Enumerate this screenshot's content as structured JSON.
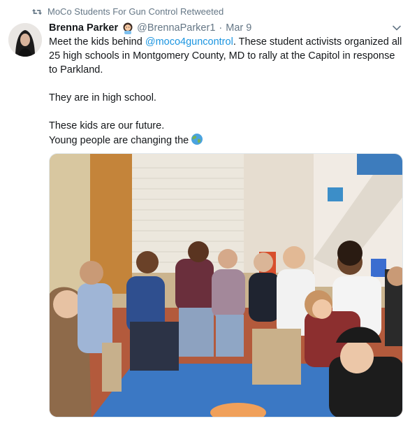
{
  "retweet": {
    "label": "MoCo Students For Gun Control Retweeted",
    "icon": "retweet-icon"
  },
  "author": {
    "name": "Brenna Parker",
    "handle": "@BrennaParker1",
    "separator": "·",
    "date": "Mar 9",
    "badge_icon": "woman-emoji-icon"
  },
  "tweet": {
    "line1_pre": "Meet the kids behind ",
    "mention": "@moco4guncontrol",
    "line1_post": ". These student activists organized all 25 high schools in Montgomery County, MD to rally at the Capitol in response to Parkland.",
    "line2": "They are in high school.",
    "line3": "These kids are our future.",
    "line4": "Young people are changing the",
    "line4_icon": "globe-emoji-icon"
  },
  "colors": {
    "link": "#1b95e0",
    "muted": "#657786",
    "text": "#14171a"
  },
  "photo": {
    "icon": "photo-students-group"
  }
}
